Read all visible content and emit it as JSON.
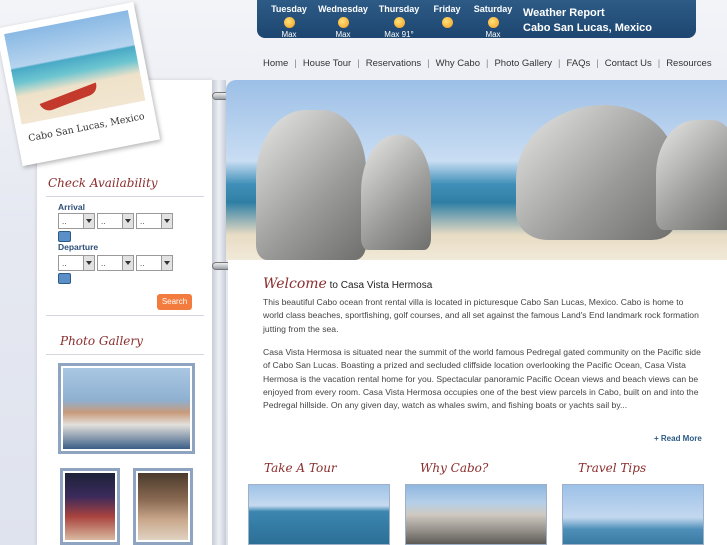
{
  "weather": {
    "days": [
      {
        "name": "Tuesday",
        "sub": "Max"
      },
      {
        "name": "Wednesday",
        "sub": "Max"
      },
      {
        "name": "Thursday",
        "sub": "Max 91°"
      },
      {
        "name": "Friday",
        "sub": ""
      },
      {
        "name": "Saturday",
        "sub": "Max"
      }
    ],
    "title": "Weather Report",
    "location": "Cabo San Lucas, Mexico"
  },
  "nav": [
    "Home",
    "House Tour",
    "Reservations",
    "Why Cabo",
    "Photo Gallery",
    "FAQs",
    "Contact Us",
    "Resources"
  ],
  "polaroid_caption": "Cabo San Lucas, Mexico",
  "availability": {
    "title": "Check Availability",
    "arrival_label": "Arrival",
    "departure_label": "Departure",
    "select_value": "..",
    "search_label": "Search"
  },
  "gallery_title": "Photo Gallery",
  "welcome": {
    "heading": "Welcome",
    "subheading": "to Casa Vista Hermosa",
    "para1": "This beautiful Cabo ocean front rental villa is located in picturesque Cabo San Lucas, Mexico. Cabo is home to world class beaches, sportfishing, golf courses, and all set against the famous Land's End landmark rock formation jutting from the sea.",
    "para2": "Casa Vista Hermosa is situated near the summit of the world famous Pedregal gated community on the Pacific side of Cabo San Lucas. Boasting a prized and secluded cliffside location overlooking the Pacific Ocean, Casa Vista Hermosa is the vacation rental home for you. Spectacular panoramic Pacific Ocean views and beach views can be enjoyed from every room. Casa Vista Hermosa occupies one of the best view parcels in Cabo, built on and into the Pedregal hillside. On any given day, watch as whales swim, and fishing boats or yachts sail by...",
    "read_more": "+ Read More"
  },
  "tiles": [
    "Take A Tour",
    "Why Cabo?",
    "Travel Tips"
  ],
  "colors": {
    "accent": "#8a2d2d",
    "nav_blue": "#1d4670",
    "button": "#f27b3d"
  }
}
